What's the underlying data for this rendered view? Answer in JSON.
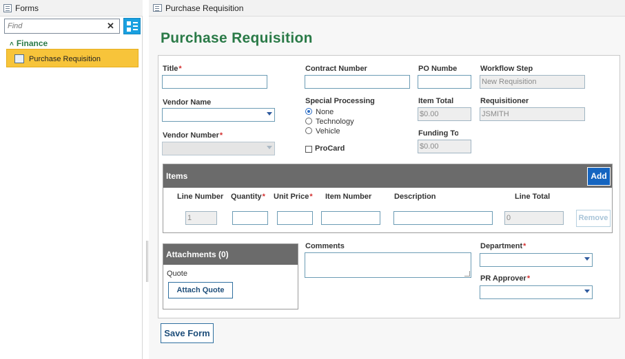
{
  "left_panel": {
    "title": "Forms",
    "search_placeholder": "Find",
    "clear_label": "✕",
    "category": "Finance",
    "selected_form": "Purchase Requisition"
  },
  "right_panel": {
    "tab_title": "Purchase Requisition"
  },
  "form": {
    "title": "Purchase Requisition",
    "fields": {
      "title_label": "Title",
      "contract_number_label": "Contract Number",
      "po_number_label": "PO Numbe",
      "workflow_step_label": "Workflow Step",
      "workflow_step_value": "New Requisition",
      "vendor_name_label": "Vendor Name",
      "special_processing_label": "Special Processing",
      "special_processing_options": [
        "None",
        "Technology",
        "Vehicle"
      ],
      "special_processing_selected": "None",
      "item_total_label": "Item Total",
      "item_total_value": "$0.00",
      "requisitioner_label": "Requisitioner",
      "requisitioner_value": "JSMITH",
      "vendor_number_label": "Vendor Number",
      "funding_label": "Funding To",
      "funding_value": "$0.00",
      "procard_label": "ProCard"
    },
    "required_marker": "*",
    "items": {
      "title": "Items",
      "add_label": "Add",
      "columns": [
        "Line Number",
        "Quantity",
        "Unit Price",
        "Item Number",
        "Description",
        "Line Total"
      ],
      "row": {
        "line_number": "1",
        "line_total": "0"
      },
      "remove_label": "Remove"
    },
    "attachments": {
      "title": "Attachments (0)",
      "quote_label": "Quote",
      "attach_button": "Attach Quote"
    },
    "comments_label": "Comments",
    "department_label": "Department",
    "pr_approver_label": "PR Approver",
    "save_label": "Save Form"
  },
  "colors": {
    "accent_green": "#2a7a47",
    "selected_item": "#f7c43a",
    "add_button": "#1565c0",
    "section_bar": "#6b6b6b",
    "required": "#d32f2f"
  }
}
